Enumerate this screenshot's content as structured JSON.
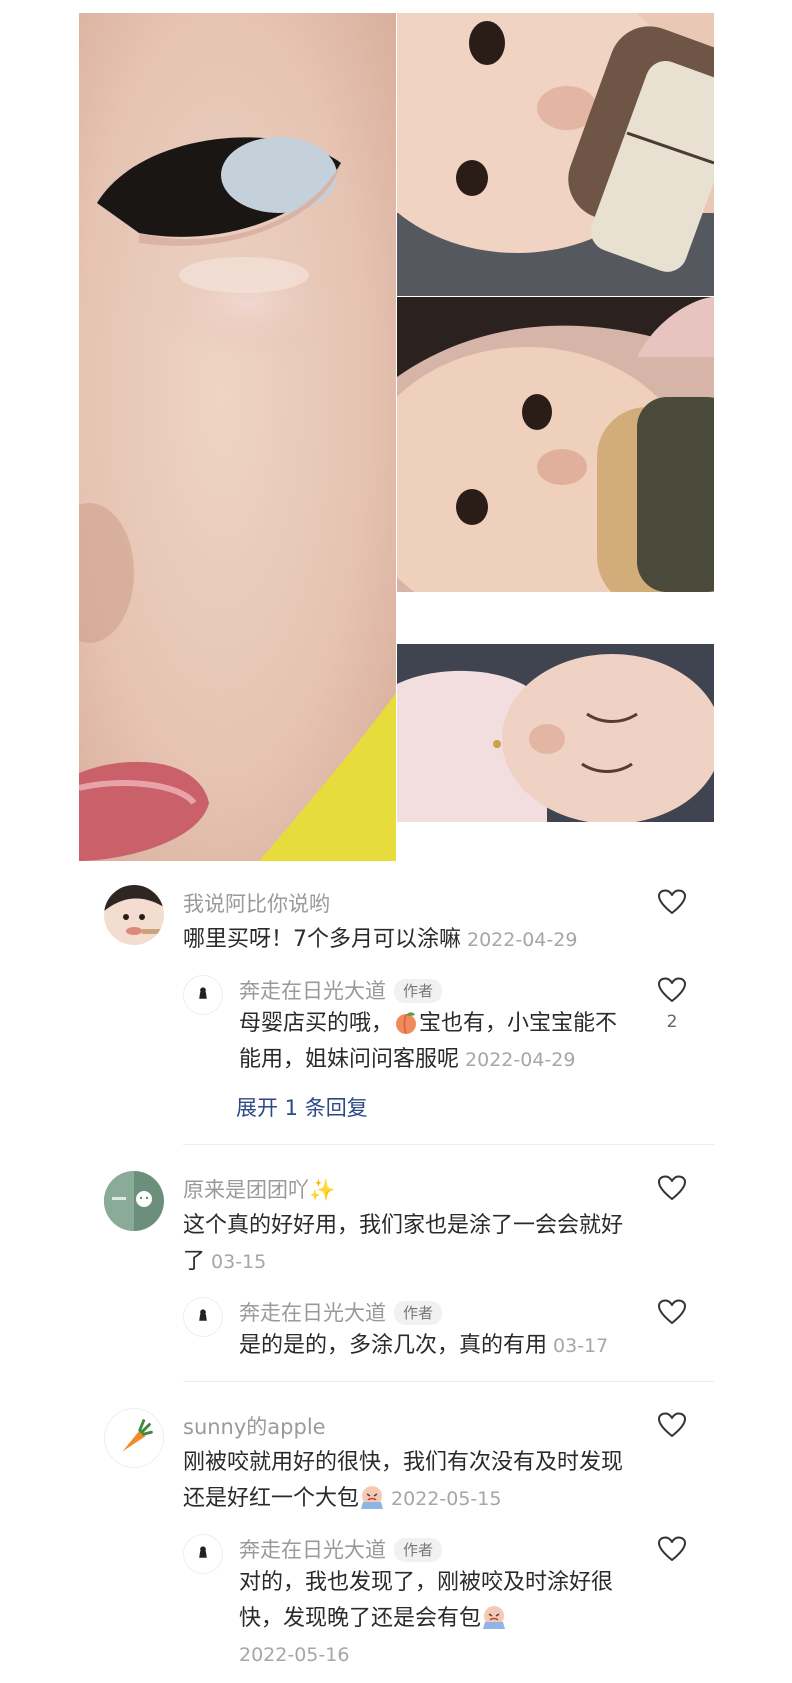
{
  "collage": {
    "photos": [
      {
        "id": "main",
        "subject": "close-up of baby eye and cheek"
      },
      {
        "id": "feed-1",
        "subject": "baby drinking from bottle"
      },
      {
        "id": "feed-2",
        "subject": "baby drinking from bottle"
      },
      {
        "id": "sleep",
        "subject": "baby sleeping"
      }
    ]
  },
  "comments": [
    {
      "username": "我说阿比你说哟",
      "text": "哪里买呀！7个多月可以涂嘛",
      "date": "2022-04-29",
      "like_icon": "heart-outline-icon",
      "reply": {
        "username": "奔走在日光大道",
        "badge": "作者",
        "text_before_emoji": "母婴店买的哦，",
        "emoji": "peach-emoji",
        "text_after_emoji": "宝也有，小宝宝能不能用，姐妹问问客服呢",
        "date": "2022-04-29",
        "likes": "2"
      },
      "expand_label": "展开 1 条回复"
    },
    {
      "username": "原来是团团吖✨",
      "text": "这个真的好好用，我们家也是涂了一会会就好了",
      "date": "03-15",
      "reply": {
        "username": "奔走在日光大道",
        "badge": "作者",
        "text": "是的是的，多涂几次，真的有用",
        "date": "03-17"
      }
    },
    {
      "username": "sunny的apple",
      "text": "刚被咬就用好的很快，我们有次没有及时发现还是好红一个大包",
      "date": "2022-05-15",
      "emoji": "crying-emoji",
      "reply": {
        "username": "奔走在日光大道",
        "badge": "作者",
        "text": "对的，我也发现了，刚被咬及时涂好很快，发现晚了还是会有包",
        "emoji": "crying-emoji",
        "date": "2022-05-16"
      }
    }
  ],
  "colors": {
    "username": "#9a9a9a",
    "body": "#2a2a2a",
    "date": "#a6a6a6",
    "link": "#2d4a86",
    "divider": "#ececec"
  }
}
